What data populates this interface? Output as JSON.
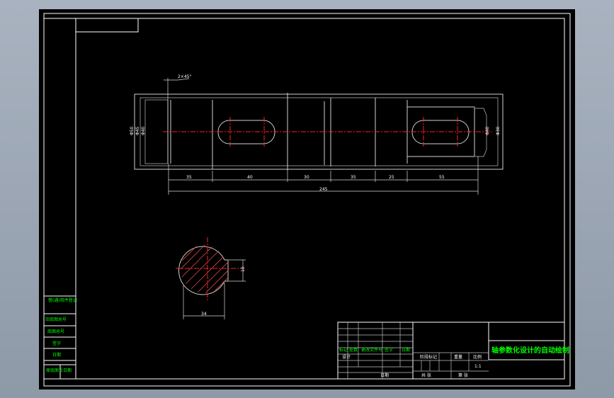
{
  "title_block": {
    "title": "轴参数化设计的自动绘制",
    "sign_labels": [
      "标记",
      "处数",
      "更改文件号",
      "签字",
      "日期"
    ],
    "designer_label": "设计",
    "stage_label": "阶段标记",
    "weight_label": "重量",
    "scale_label": "比例",
    "scale_value": "1:1",
    "sheet_total": "共  张",
    "sheet_num": "第  张",
    "date_label": "日期"
  },
  "side_table": {
    "rows": [
      "借(通)用件登记",
      "旧底图总号",
      "底图总号",
      "签字",
      "日期"
    ],
    "bottom": [
      "原底图号",
      "日期"
    ]
  },
  "dimensions": {
    "chamfer": "2×45°",
    "segments": [
      "35",
      "40",
      "30",
      "35",
      "25",
      "55"
    ],
    "overall": "245",
    "diameters_left": [
      "Φ50",
      "Φ45",
      "Φ40"
    ],
    "diameters_right": [
      "Φ40",
      "Φ30"
    ],
    "section_width": "34",
    "key_width": "10"
  },
  "colors": {
    "background": "#000000",
    "lines": "#ffffff",
    "centerline": "#ff2020",
    "text_highlight": "#00ff00"
  }
}
